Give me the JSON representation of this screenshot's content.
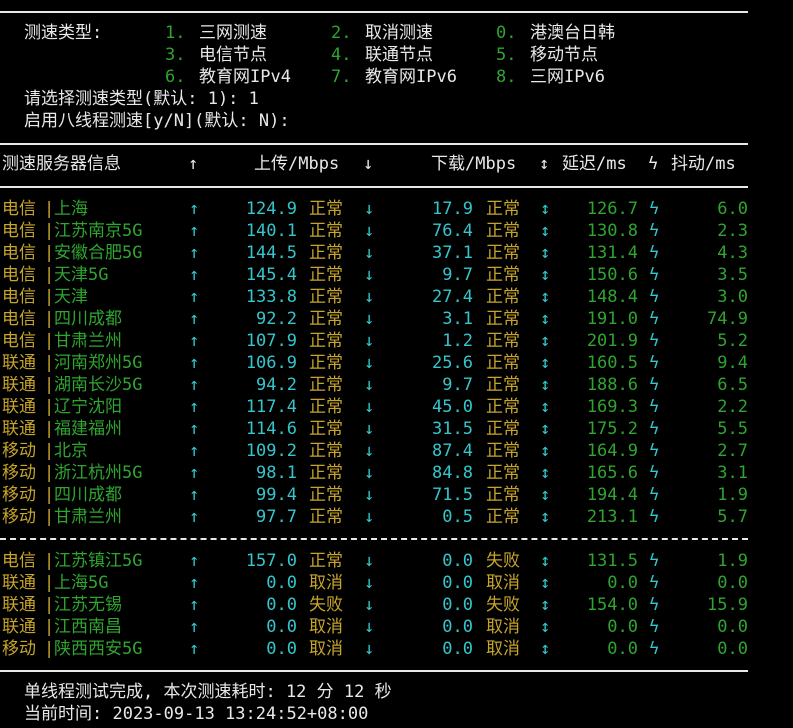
{
  "menu": {
    "label": "测速类型:",
    "options": [
      {
        "num": "1.",
        "text": "三网测速"
      },
      {
        "num": "2.",
        "text": "取消测速"
      },
      {
        "num": "0.",
        "text": "港澳台日韩"
      },
      {
        "num": "3.",
        "text": "电信节点"
      },
      {
        "num": "4.",
        "text": "联通节点"
      },
      {
        "num": "5.",
        "text": "移动节点"
      },
      {
        "num": "6.",
        "text": "教育网IPv4"
      },
      {
        "num": "7.",
        "text": "教育网IPv6"
      },
      {
        "num": "8.",
        "text": "三网IPv6"
      }
    ],
    "prompt1": "请选择测速类型(默认: 1): 1",
    "prompt2": "启用八线程测速[y/N](默认: N):"
  },
  "table": {
    "headers": {
      "server": "测速服务器信息",
      "up_arrow": "↑",
      "upload": "上传/Mbps",
      "down_arrow": "↓",
      "download": "下载/Mbps",
      "latency_icon": "↕",
      "latency": "延迟/ms",
      "jitter_icon": "ϟ",
      "jitter": "抖动/ms"
    },
    "rows": [
      {
        "isp": "电信",
        "node": "上海",
        "up": "124.9",
        "up_status": "正常",
        "down": "17.9",
        "down_status": "正常",
        "latency": "126.7",
        "jitter": "6.0"
      },
      {
        "isp": "电信",
        "node": "江苏南京5G",
        "up": "140.1",
        "up_status": "正常",
        "down": "76.4",
        "down_status": "正常",
        "latency": "130.8",
        "jitter": "2.3"
      },
      {
        "isp": "电信",
        "node": "安徽合肥5G",
        "up": "144.5",
        "up_status": "正常",
        "down": "37.1",
        "down_status": "正常",
        "latency": "131.4",
        "jitter": "4.3"
      },
      {
        "isp": "电信",
        "node": "天津5G",
        "up": "145.4",
        "up_status": "正常",
        "down": "9.7",
        "down_status": "正常",
        "latency": "150.6",
        "jitter": "3.5"
      },
      {
        "isp": "电信",
        "node": "天津",
        "up": "133.8",
        "up_status": "正常",
        "down": "27.4",
        "down_status": "正常",
        "latency": "148.4",
        "jitter": "3.0"
      },
      {
        "isp": "电信",
        "node": "四川成都",
        "up": "92.2",
        "up_status": "正常",
        "down": "3.1",
        "down_status": "正常",
        "latency": "191.0",
        "jitter": "74.9"
      },
      {
        "isp": "电信",
        "node": "甘肃兰州",
        "up": "107.9",
        "up_status": "正常",
        "down": "1.2",
        "down_status": "正常",
        "latency": "201.9",
        "jitter": "5.2"
      },
      {
        "isp": "联通",
        "node": "河南郑州5G",
        "up": "106.9",
        "up_status": "正常",
        "down": "25.6",
        "down_status": "正常",
        "latency": "160.5",
        "jitter": "9.4"
      },
      {
        "isp": "联通",
        "node": "湖南长沙5G",
        "up": "94.2",
        "up_status": "正常",
        "down": "9.7",
        "down_status": "正常",
        "latency": "188.6",
        "jitter": "6.5"
      },
      {
        "isp": "联通",
        "node": "辽宁沈阳",
        "up": "117.4",
        "up_status": "正常",
        "down": "45.0",
        "down_status": "正常",
        "latency": "169.3",
        "jitter": "2.2"
      },
      {
        "isp": "联通",
        "node": "福建福州",
        "up": "114.6",
        "up_status": "正常",
        "down": "31.5",
        "down_status": "正常",
        "latency": "175.2",
        "jitter": "5.5"
      },
      {
        "isp": "移动",
        "node": "北京",
        "up": "109.2",
        "up_status": "正常",
        "down": "87.4",
        "down_status": "正常",
        "latency": "164.9",
        "jitter": "2.7"
      },
      {
        "isp": "移动",
        "node": "浙江杭州5G",
        "up": "98.1",
        "up_status": "正常",
        "down": "84.8",
        "down_status": "正常",
        "latency": "165.6",
        "jitter": "3.1"
      },
      {
        "isp": "移动",
        "node": "四川成都",
        "up": "99.4",
        "up_status": "正常",
        "down": "71.5",
        "down_status": "正常",
        "latency": "194.4",
        "jitter": "1.9"
      },
      {
        "isp": "移动",
        "node": "甘肃兰州",
        "up": "97.7",
        "up_status": "正常",
        "down": "0.5",
        "down_status": "正常",
        "latency": "213.1",
        "jitter": "5.7"
      }
    ],
    "rows2": [
      {
        "isp": "电信",
        "node": "江苏镇江5G",
        "up": "157.0",
        "up_status": "正常",
        "down": "0.0",
        "down_status": "失败",
        "latency": "131.5",
        "jitter": "1.9"
      },
      {
        "isp": "联通",
        "node": "上海5G",
        "up": "0.0",
        "up_status": "取消",
        "down": "0.0",
        "down_status": "取消",
        "latency": "0.0",
        "jitter": "0.0"
      },
      {
        "isp": "联通",
        "node": "江苏无锡",
        "up": "0.0",
        "up_status": "失败",
        "down": "0.0",
        "down_status": "失败",
        "latency": "154.0",
        "jitter": "15.9"
      },
      {
        "isp": "联通",
        "node": "江西南昌",
        "up": "0.0",
        "up_status": "取消",
        "down": "0.0",
        "down_status": "取消",
        "latency": "0.0",
        "jitter": "0.0"
      },
      {
        "isp": "移动",
        "node": "陕西西安5G",
        "up": "0.0",
        "up_status": "取消",
        "down": "0.0",
        "down_status": "取消",
        "latency": "0.0",
        "jitter": "0.0"
      }
    ]
  },
  "footer": {
    "done": "单线程测试完成, 本次测速耗时: 12 分 12 秒",
    "time": "当前时间: 2023-09-13 13:24:52+08:00"
  }
}
